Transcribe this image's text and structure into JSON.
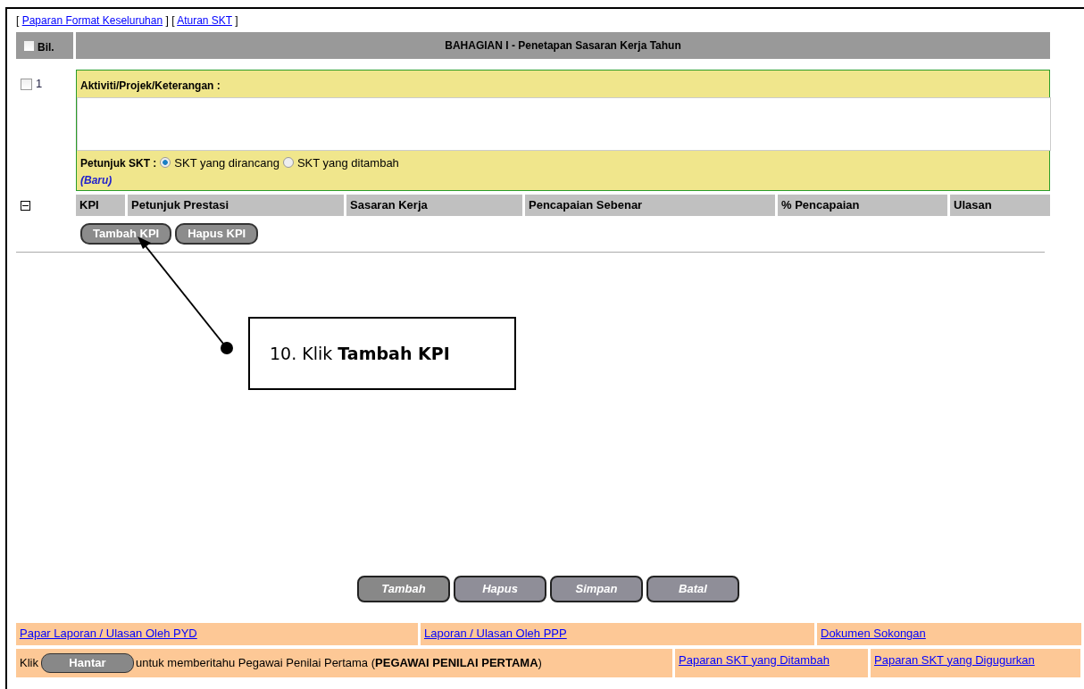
{
  "top_links": [
    {
      "open": "[",
      "label": "Paparan Format Keseluruhan",
      "close": "]"
    },
    {
      "open": "[",
      "label": "Aturan SKT",
      "close": "]"
    }
  ],
  "header": {
    "select_all_checked": false,
    "bil_label": "Bil.",
    "title": "BAHAGIAN I - Penetapan Sasaran Kerja Tahun"
  },
  "items": [
    {
      "checked": false,
      "number": "1",
      "activity_label": "Aktiviti/Projek/Keterangan :",
      "hint_label": "Petunjuk SKT :",
      "options": [
        {
          "label": "SKT yang dirancang",
          "selected": true
        },
        {
          "label": "SKT yang ditambah",
          "selected": false
        }
      ],
      "status": "(Baru)",
      "expanded": true,
      "kpi_columns": [
        "KPI",
        "Petunjuk Prestasi",
        "Sasaran Kerja",
        "Pencapaian Sebenar",
        "% Pencapaian",
        "Ulasan"
      ],
      "kpi_buttons": [
        "Tambah KPI",
        "Hapus KPI"
      ]
    }
  ],
  "actions": [
    "Tambah",
    "Hapus",
    "Simpan",
    "Batal"
  ],
  "footer": {
    "links": [
      "Papar Laporan / Ulasan Oleh PYD",
      "Laporan / Ulasan Oleh PPP",
      "Dokumen Sokongan"
    ],
    "notice_before": "Klik",
    "send_button": "Hantar",
    "notice_after": "untuk memberitahu Pegawai Penilai Pertama (**PEGAWAI PENILAI PERTAMA**)",
    "extra_links": [
      "Paparan SKT yang Ditambah",
      "Paparan SKT yang Digugurkan"
    ]
  },
  "callout": {
    "text": "10. Klik **Tambah KPI**"
  }
}
